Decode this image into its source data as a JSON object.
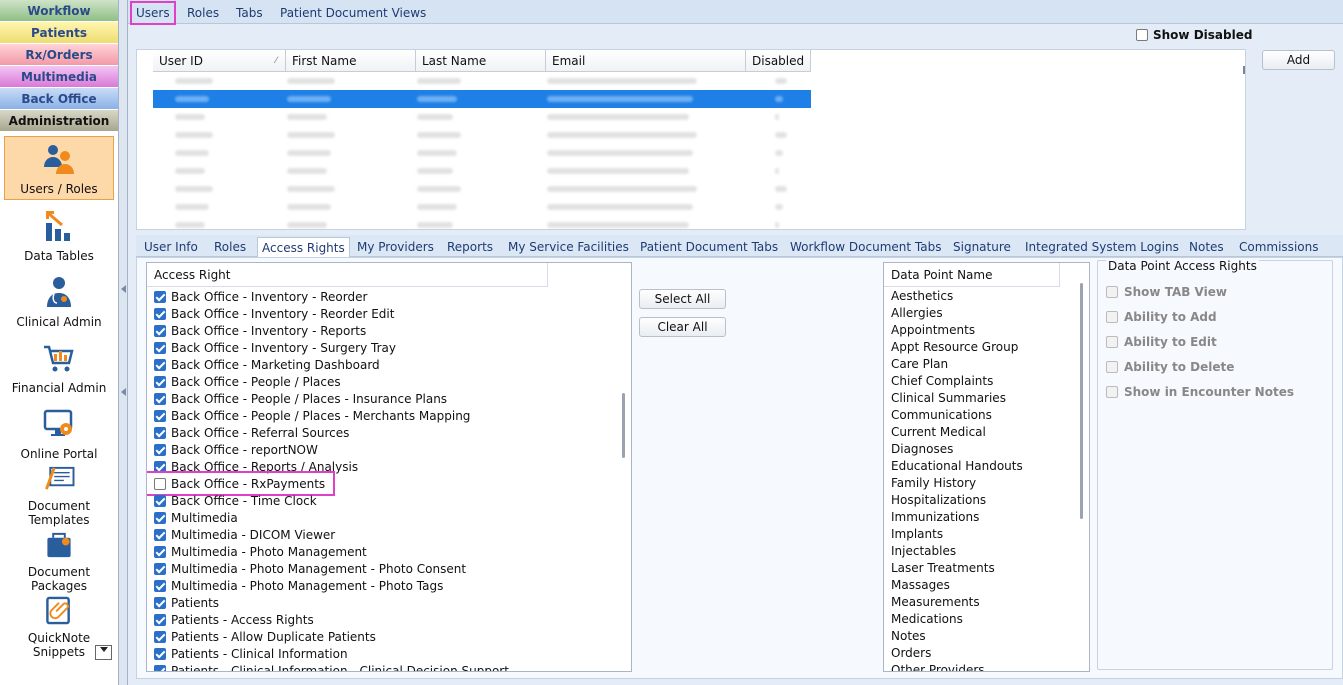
{
  "modules": [
    "Workflow",
    "Patients",
    "Rx/Orders",
    "Multimedia",
    "Back Office",
    "Administration"
  ],
  "nav": {
    "users_roles": "Users / Roles",
    "data_tables": "Data Tables",
    "clinical_admin": "Clinical Admin",
    "financial_admin": "Financial Admin",
    "online_portal": "Online Portal",
    "document_templates_1": "Document",
    "document_templates_2": "Templates",
    "document_packages_1": "Document",
    "document_packages_2": "Packages",
    "quicknote_1": "QuickNote",
    "quicknote_2": "Snippets"
  },
  "top_tabs": [
    "Users",
    "Roles",
    "Tabs",
    "Patient Document Views"
  ],
  "show_disabled": "Show Disabled",
  "add": "Add",
  "grid_headers": [
    "User ID",
    "First Name",
    "Last Name",
    "Email",
    "Disabled"
  ],
  "sub_tabs": [
    "User Info",
    "Roles",
    "Access Rights",
    "My Providers",
    "Reports",
    "My Service Facilities",
    "Patient Document Tabs",
    "Workflow Document Tabs",
    "Signature",
    "Integrated System Logins",
    "Notes",
    "Commissions"
  ],
  "access_right_header": "Access Right",
  "access_rights": [
    {
      "label": "Back Office - Inventory - Reorder",
      "checked": true
    },
    {
      "label": "Back Office - Inventory - Reorder Edit",
      "checked": true
    },
    {
      "label": "Back Office - Inventory - Reports",
      "checked": true
    },
    {
      "label": "Back Office - Inventory - Surgery Tray",
      "checked": true
    },
    {
      "label": "Back Office - Marketing Dashboard",
      "checked": true
    },
    {
      "label": "Back Office - People / Places",
      "checked": true
    },
    {
      "label": "Back Office - People / Places - Insurance Plans",
      "checked": true
    },
    {
      "label": "Back Office - People / Places - Merchants Mapping",
      "checked": true
    },
    {
      "label": "Back Office - Referral Sources",
      "checked": true
    },
    {
      "label": "Back Office - reportNOW",
      "checked": true
    },
    {
      "label": "Back Office - Reports / Analysis",
      "checked": true
    },
    {
      "label": "Back Office - RxPayments",
      "checked": false
    },
    {
      "label": "Back Office - Time Clock",
      "checked": true
    },
    {
      "label": "Multimedia",
      "checked": true
    },
    {
      "label": "Multimedia - DICOM Viewer",
      "checked": true
    },
    {
      "label": "Multimedia - Photo Management",
      "checked": true
    },
    {
      "label": "Multimedia - Photo Management - Photo Consent",
      "checked": true
    },
    {
      "label": "Multimedia - Photo Management - Photo Tags",
      "checked": true
    },
    {
      "label": "Patients",
      "checked": true
    },
    {
      "label": "Patients - Access Rights",
      "checked": true
    },
    {
      "label": "Patients - Allow Duplicate Patients",
      "checked": true
    },
    {
      "label": "Patients - Clinical Information",
      "checked": true
    },
    {
      "label": "Patients - Clinical Information - Clinical Decision Support",
      "checked": true
    }
  ],
  "select_all": "Select All",
  "clear_all": "Clear All",
  "data_point_header": "Data Point Name",
  "data_points": [
    "Aesthetics",
    "Allergies",
    "Appointments",
    "Appt Resource Group",
    "Care Plan",
    "Chief Complaints",
    "Clinical Summaries",
    "Communications",
    "Current Medical",
    "Diagnoses",
    "Educational Handouts",
    "Family History",
    "Hospitalizations",
    "Immunizations",
    "Implants",
    "Injectables",
    "Laser Treatments",
    "Massages",
    "Measurements",
    "Medications",
    "Notes",
    "Orders",
    "Other Providers"
  ],
  "dp_access_title": "Data Point Access Rights",
  "dp_access_items": [
    "Show TAB View",
    "Ability to Add",
    "Ability to Edit",
    "Ability to Delete",
    "Show in Encounter Notes"
  ],
  "colors": {
    "highlight": "#e040c8",
    "selected_row": "#1e7fe6",
    "checkbox": "#2a6fc9"
  }
}
